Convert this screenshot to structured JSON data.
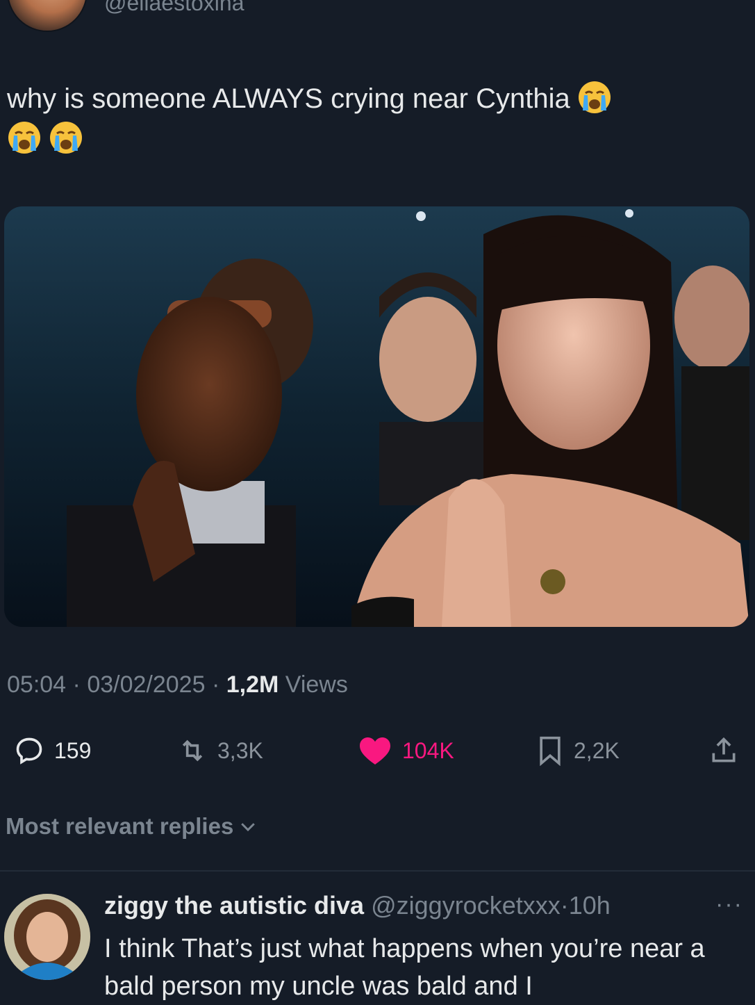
{
  "tweet": {
    "handle": "@ellaestoxina",
    "text": "why is someone ALWAYS crying near Cynthia",
    "emoji": "loudly-crying-face",
    "time": "05:04",
    "date": "03/02/2025",
    "views_count": "1,2M",
    "views_label": "Views",
    "separator": "·"
  },
  "actions": {
    "replies": "159",
    "retweets": "3,3K",
    "likes": "104K",
    "bookmarks": "2,2K",
    "like_color": "#f91880"
  },
  "replies_sort": {
    "label": "Most relevant replies"
  },
  "reply": {
    "name": "ziggy the autistic diva",
    "handle": "@ziggyrocketxxx",
    "time": "10h",
    "separator": "·",
    "more": "···",
    "text": "I think That’s just what happens when you’re near a bald person my uncle was bald and I"
  },
  "colors": {
    "background": "#151c27",
    "muted": "#7b8590",
    "text": "#e7e9ea"
  }
}
